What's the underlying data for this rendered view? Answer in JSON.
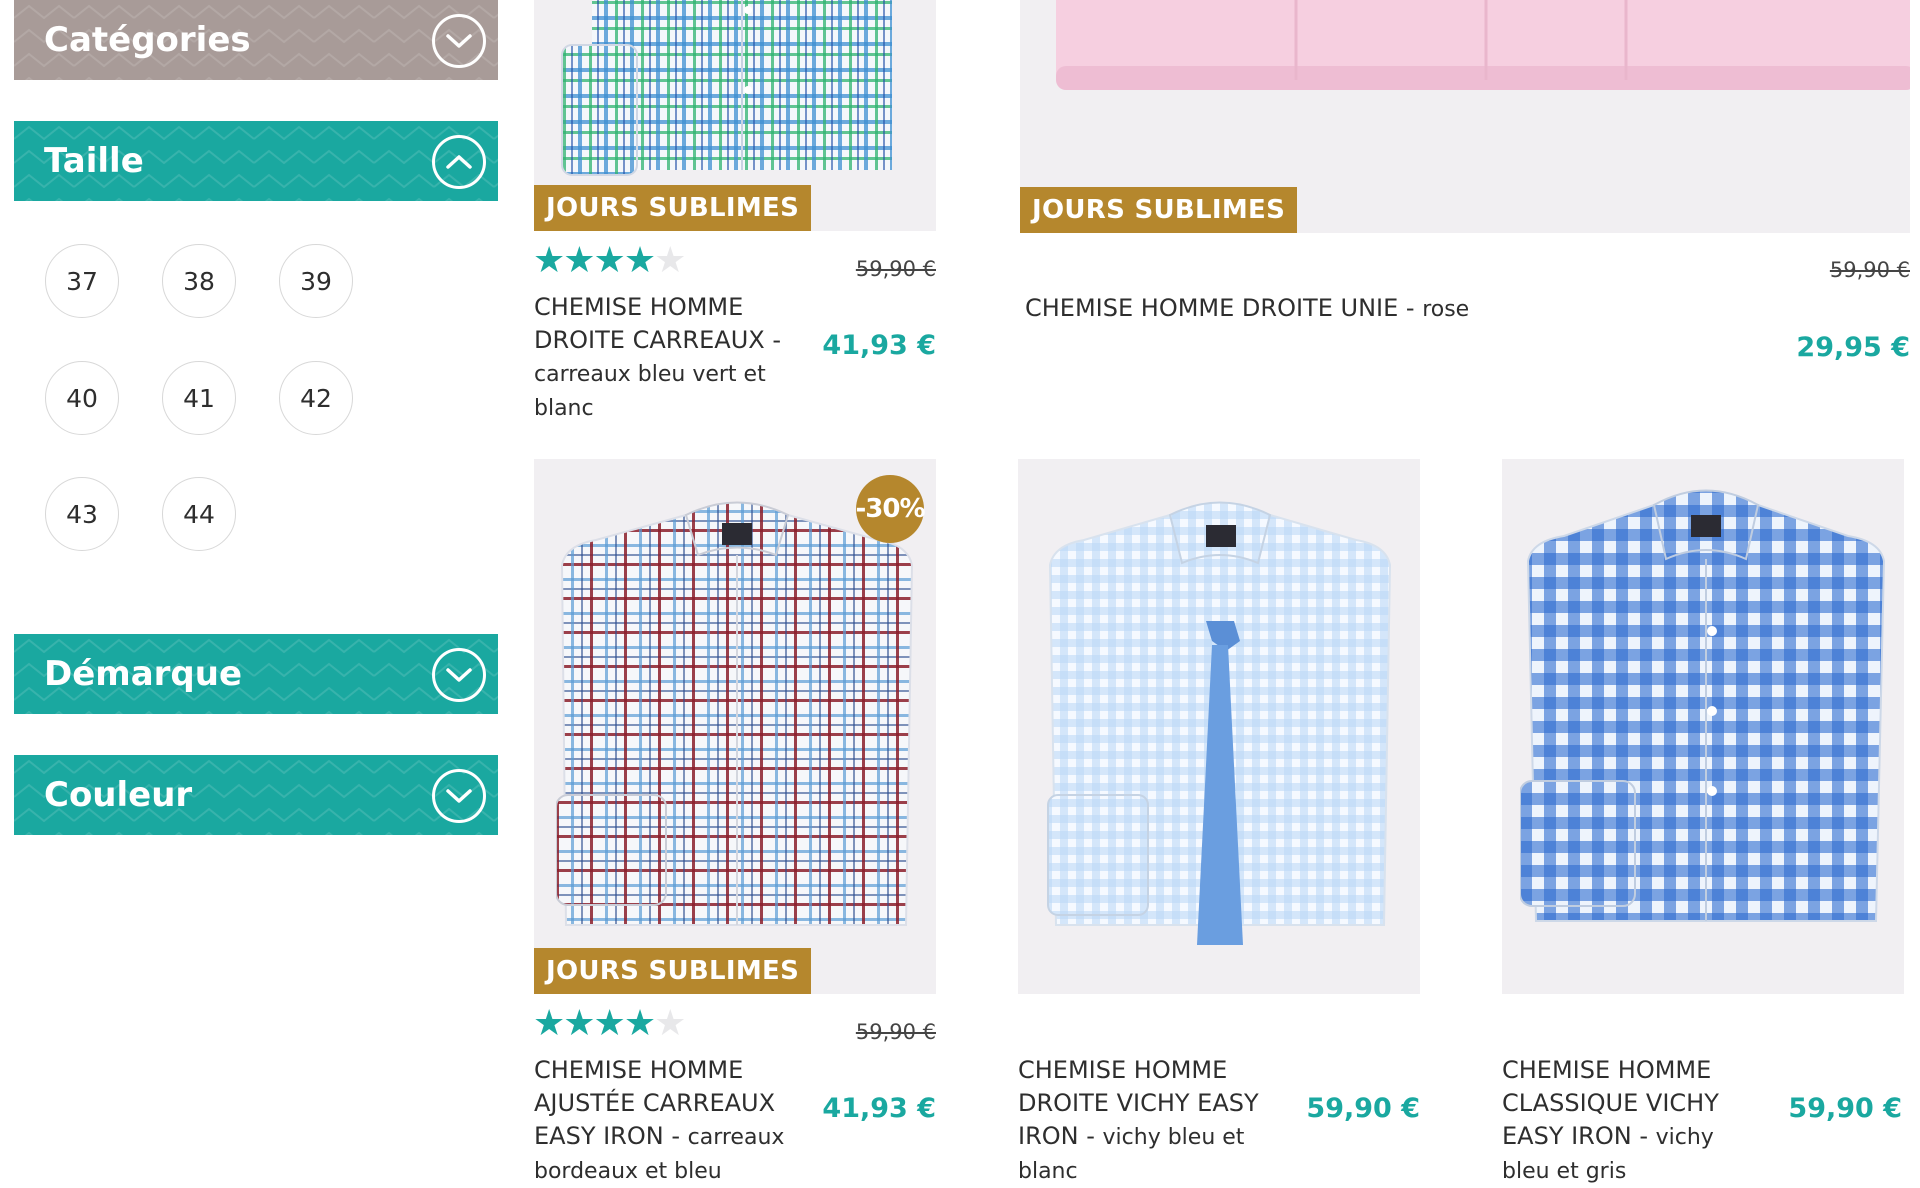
{
  "filters": {
    "categories": {
      "label": "Catégories",
      "state": "collapsed"
    },
    "taille": {
      "label": "Taille",
      "state": "expanded",
      "sizes": [
        "37",
        "38",
        "39",
        "40",
        "41",
        "42",
        "43",
        "44"
      ]
    },
    "demarque": {
      "label": "Démarque",
      "state": "collapsed"
    },
    "couleur": {
      "label": "Couleur",
      "state": "collapsed"
    }
  },
  "products": [
    {
      "badge": "JOURS SUBLIMES",
      "rating": 4,
      "rating_max": 5,
      "old_price": "59,90 €",
      "price": "41,93 €",
      "title": "CHEMISE HOMME DROITE CARREAUX",
      "separator": " - ",
      "variant": "carreaux bleu vert et blanc",
      "image_icon": "plaid-shirt-green-blue-icon"
    },
    {
      "badge": "JOURS SUBLIMES",
      "old_price": "59,90 €",
      "price": "29,95 €",
      "title": "CHEMISE HOMME DROITE UNIE",
      "separator": " - ",
      "variant": "rose",
      "image_icon": "pink-shirt-icon"
    },
    {
      "badge": "JOURS SUBLIMES",
      "discount": "-30%",
      "rating": 4,
      "rating_max": 5,
      "old_price": "59,90 €",
      "price": "41,93 €",
      "title": "CHEMISE HOMME AJUSTÉE CARREAUX EASY IRON",
      "separator": " - ",
      "variant": "carreaux bordeaux et bleu",
      "image_icon": "plaid-shirt-burgundy-blue-icon"
    },
    {
      "price": "59,90 €",
      "title": "CHEMISE HOMME DROITE VICHY EASY IRON",
      "separator": " - ",
      "variant": "vichy bleu et blanc",
      "image_icon": "gingham-shirt-with-tie-icon"
    },
    {
      "price": "59,90 €",
      "title": "CHEMISE HOMME CLASSIQUE VICHY EASY IRON",
      "separator": " - ",
      "variant": "vichy bleu et gris",
      "image_icon": "blue-gingham-shirt-icon"
    }
  ],
  "colors": {
    "teal": "#1aa8a0",
    "grey_header": "#a89b98",
    "badge_gold": "#b5872d",
    "image_bg": "#f1eff2"
  }
}
